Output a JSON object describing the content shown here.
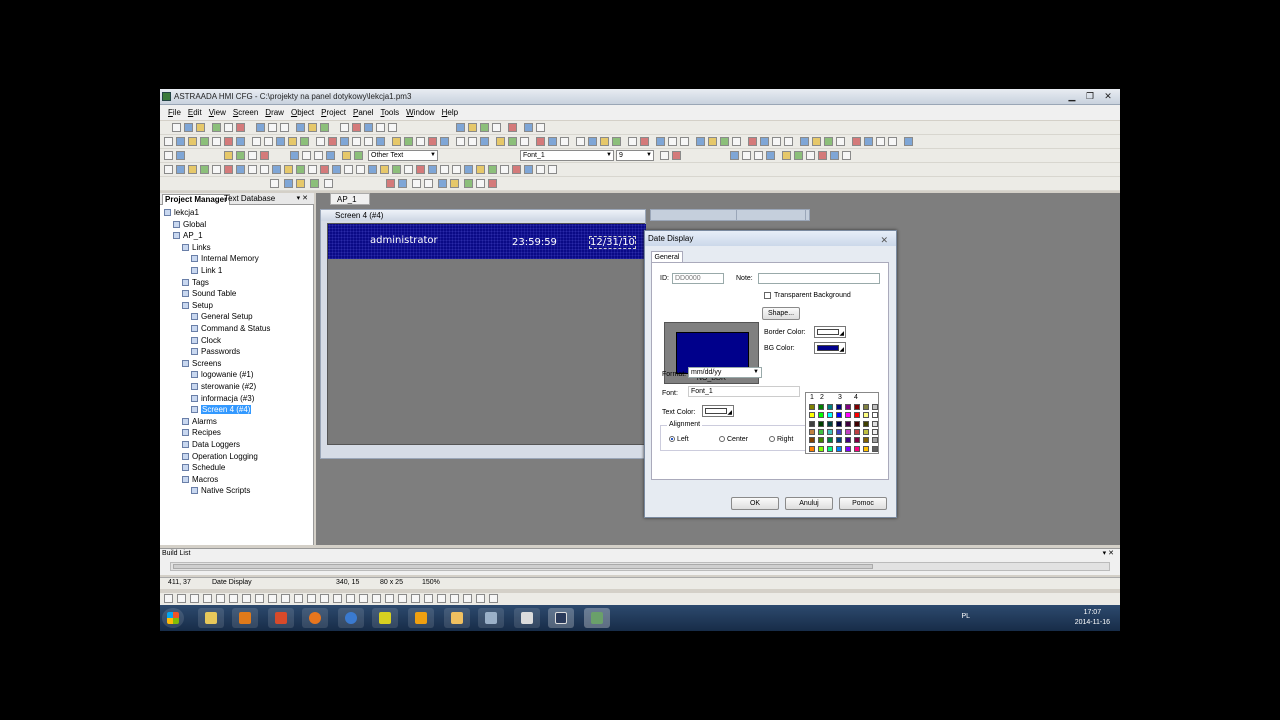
{
  "window": {
    "title": "ASTRAADA HMI CFG - C:\\projekty na panel dotykowy\\lekcja1.pm3",
    "min": "▁",
    "max": "❐",
    "close": "✕"
  },
  "menu": [
    "File",
    "Edit",
    "View",
    "Screen",
    "Draw",
    "Object",
    "Project",
    "Panel",
    "Tools",
    "Window",
    "Help"
  ],
  "toolbar": {
    "text_style": "Other Text",
    "font": "Font_1",
    "font_size": "9"
  },
  "project_manager": {
    "tabs": [
      "Project Manager",
      "Text Database"
    ],
    "tree": [
      {
        "label": "lekcja1",
        "indent": 0
      },
      {
        "label": "Global",
        "indent": 1
      },
      {
        "label": "AP_1",
        "indent": 1
      },
      {
        "label": "Links",
        "indent": 2
      },
      {
        "label": "Internal Memory",
        "indent": 3
      },
      {
        "label": "Link 1",
        "indent": 3
      },
      {
        "label": "Tags",
        "indent": 2
      },
      {
        "label": "Sound Table",
        "indent": 2
      },
      {
        "label": "Setup",
        "indent": 2
      },
      {
        "label": "General Setup",
        "indent": 3
      },
      {
        "label": "Command & Status",
        "indent": 3
      },
      {
        "label": "Clock",
        "indent": 3
      },
      {
        "label": "Passwords",
        "indent": 3
      },
      {
        "label": "Screens",
        "indent": 2
      },
      {
        "label": "logowanie (#1)",
        "indent": 3
      },
      {
        "label": "sterowanie (#2)",
        "indent": 3
      },
      {
        "label": "informacja (#3)",
        "indent": 3
      },
      {
        "label": "Screen 4 (#4)",
        "indent": 3,
        "selected": true
      },
      {
        "label": "Alarms",
        "indent": 2
      },
      {
        "label": "Recipes",
        "indent": 2
      },
      {
        "label": "Data Loggers",
        "indent": 2
      },
      {
        "label": "Operation Logging",
        "indent": 2
      },
      {
        "label": "Schedule",
        "indent": 2
      },
      {
        "label": "Macros",
        "indent": 2
      },
      {
        "label": "Native Scripts",
        "indent": 3
      }
    ]
  },
  "workspace": {
    "tab": "AP_1",
    "screen_title": "Screen 4 (#4)",
    "banner_user": "administrator",
    "banner_time": "23:59:59",
    "banner_date": "12/31/10"
  },
  "dialog": {
    "title": "Date Display",
    "tab": "General",
    "id_label": "ID:",
    "id_value": "DD0000",
    "note_label": "Note:",
    "note_value": "",
    "transparent_label": "Transparent Background",
    "shape_button": "Shape...",
    "preview_caption": "NO_BDR",
    "border_color_label": "Border Color:",
    "bg_color_label": "BG Color:",
    "format_label": "Format:",
    "format_value": "mm/dd/yy",
    "font_label": "Font:",
    "font_value": "Font_1",
    "text_color_label": "Text Color:",
    "alignment_label": "Alignment",
    "align_left": "Left",
    "align_center": "Center",
    "align_right": "Right",
    "ok": "OK",
    "cancel": "Anuluj",
    "help": "Pomoc",
    "palette_tabs": [
      "1",
      "2",
      "3",
      "4"
    ],
    "colors": {
      "border": "#ffffff",
      "bg": "#00008b",
      "text": "#ffffff"
    }
  },
  "palette_colors": [
    "#808000",
    "#008000",
    "#008080",
    "#000080",
    "#800080",
    "#800000",
    "#808040",
    "#c0c0c0",
    "#ffff00",
    "#00ff00",
    "#00ffff",
    "#0000ff",
    "#ff00ff",
    "#ff0000",
    "#ffff80",
    "#ffffff",
    "#404040",
    "#004000",
    "#004040",
    "#000040",
    "#400040",
    "#400000",
    "#404000",
    "#e0e0e0",
    "#c08040",
    "#40c040",
    "#40c0c0",
    "#4040c0",
    "#c040c0",
    "#c04040",
    "#c0c040",
    "#f0f0f0",
    "#804000",
    "#408000",
    "#008040",
    "#004080",
    "#400080",
    "#800040",
    "#806000",
    "#a0a0a0",
    "#ff8000",
    "#80ff00",
    "#00ff80",
    "#0080ff",
    "#8000ff",
    "#ff0080",
    "#ffc000",
    "#606060"
  ],
  "build_list": {
    "label": "Build List"
  },
  "status": {
    "coords": "411, 37",
    "object": "Date Display",
    "position": "340, 15",
    "size": "80 x 25",
    "zoom": "150%"
  },
  "taskbar": {
    "lang": "PL",
    "time": "17:07",
    "date": "2014-11-16"
  }
}
